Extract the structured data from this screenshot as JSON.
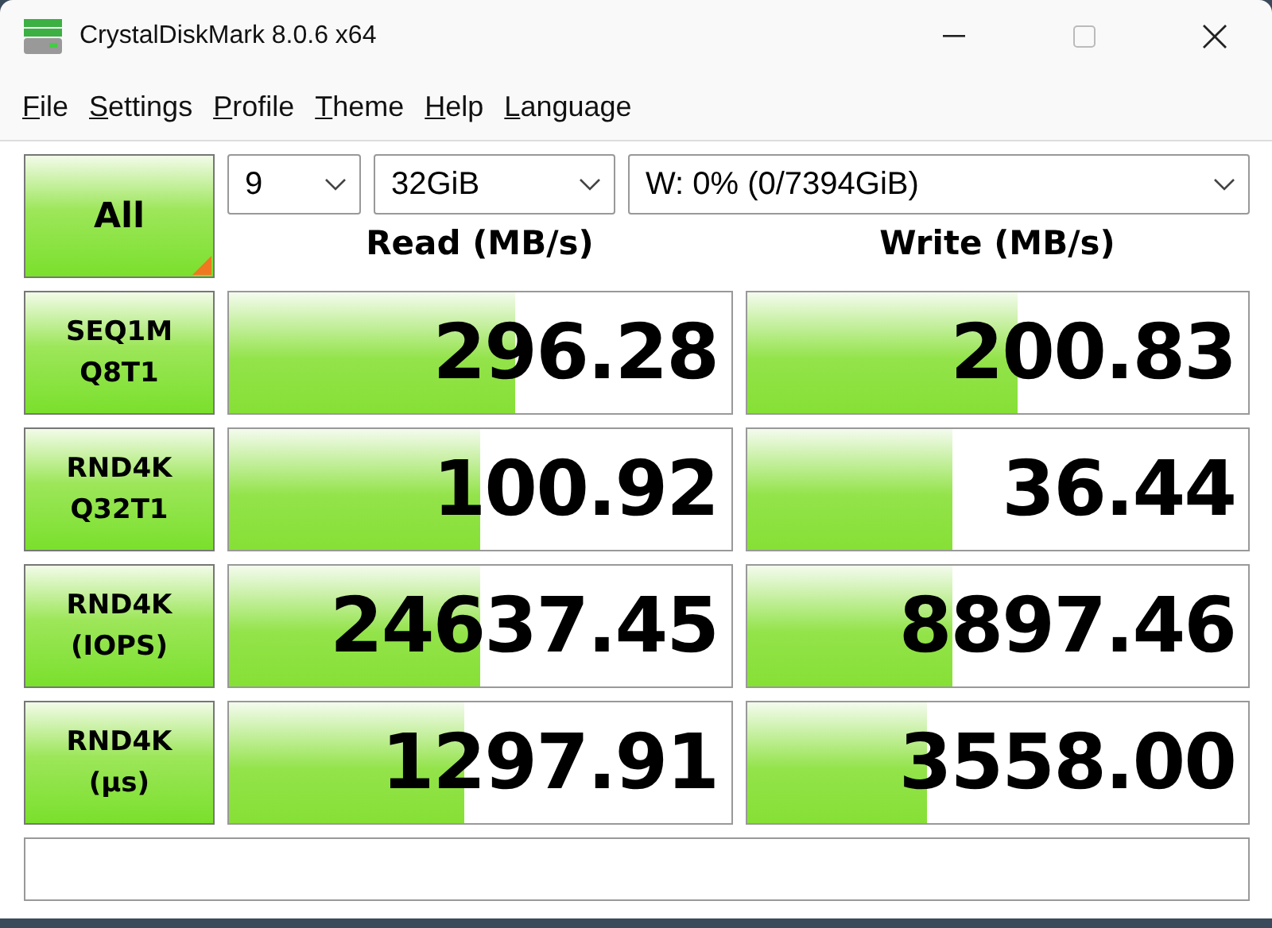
{
  "window": {
    "title": "CrystalDiskMark 8.0.6 x64"
  },
  "menu": [
    "File",
    "Settings",
    "Profile",
    "Theme",
    "Help",
    "Language"
  ],
  "all_button": {
    "label": "All"
  },
  "selects": [
    {
      "value": "9"
    },
    {
      "value": "32GiB"
    },
    {
      "value": "W: 0% (0/7394GiB)"
    }
  ],
  "columns": [
    "Read (MB/s)",
    "Write (MB/s)"
  ],
  "rows": [
    {
      "test": [
        "SEQ1M",
        "Q8T1"
      ],
      "read": {
        "value": "296.28",
        "level": 0.57
      },
      "write": {
        "value": "200.83",
        "level": 0.54
      }
    },
    {
      "test": [
        "RND4K",
        "Q32T1"
      ],
      "read": {
        "value": "100.92",
        "level": 0.5
      },
      "write": {
        "value": "36.44",
        "level": 0.41
      }
    },
    {
      "test": [
        "RND4K",
        "(IOPS)"
      ],
      "read": {
        "value": "24637.45",
        "level": 0.5
      },
      "write": {
        "value": "8897.46",
        "level": 0.41
      }
    },
    {
      "test": [
        "RND4K",
        "(µs)"
      ],
      "read": {
        "value": "1297.91",
        "level": 0.47
      },
      "write": {
        "value": "3558.00",
        "level": 0.36
      }
    }
  ]
}
